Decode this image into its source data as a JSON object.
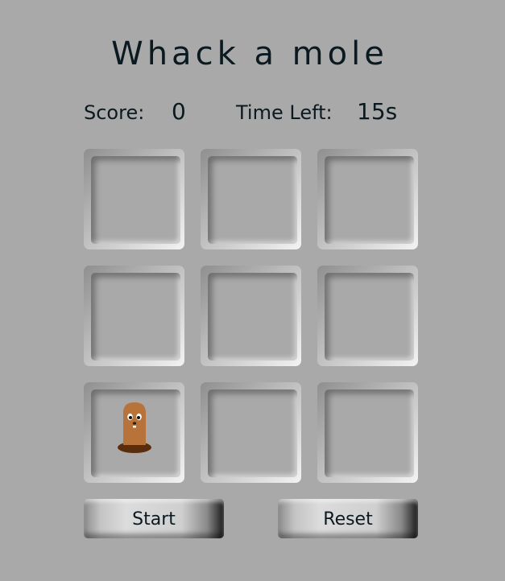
{
  "title": "Whack a mole",
  "stats": {
    "score_label": "Score:",
    "score_value": "0",
    "time_label": "Time Left:",
    "time_value": "15s"
  },
  "board": {
    "holes": [
      {
        "has_mole": false
      },
      {
        "has_mole": false
      },
      {
        "has_mole": false
      },
      {
        "has_mole": false
      },
      {
        "has_mole": false
      },
      {
        "has_mole": false
      },
      {
        "has_mole": true
      },
      {
        "has_mole": false
      },
      {
        "has_mole": false
      }
    ],
    "mole_icon": "mole-icon",
    "colors": {
      "mole_body": "#b8733a",
      "mole_hole": "#5a2d0c"
    }
  },
  "buttons": {
    "start_label": "Start",
    "reset_label": "Reset"
  }
}
